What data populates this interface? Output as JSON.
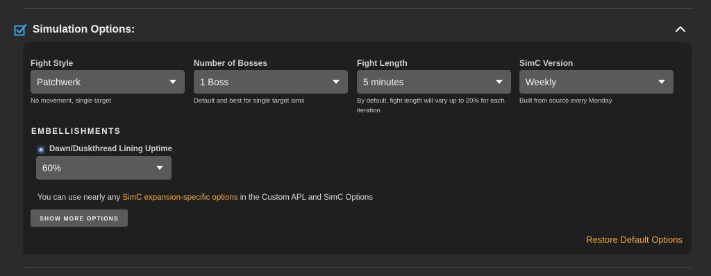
{
  "section": {
    "title": "Simulation Options:",
    "checked": true,
    "accent_color": "#3aa6e0"
  },
  "fields": [
    {
      "label": "Fight Style",
      "value": "Patchwerk",
      "helper": "No movement, single target"
    },
    {
      "label": "Number of Bosses",
      "value": "1 Boss",
      "helper": "Default and best for single target sims"
    },
    {
      "label": "Fight Length",
      "value": "5 minutes",
      "helper": "By default, fight length will vary up to 20% for each iteration"
    },
    {
      "label": "SimC Version",
      "value": "Weekly",
      "helper": "Built from source every Monday"
    }
  ],
  "embellishments": {
    "heading": "EMBELLISHMENTS",
    "item_label": "Dawn/Duskthread Lining Uptime",
    "item_value": "60%"
  },
  "info": {
    "prefix": "You can use nearly any ",
    "link": "SimC expansion-specific options",
    "suffix": " in the Custom APL and SimC Options"
  },
  "buttons": {
    "show_more": "SHOW MORE OPTIONS",
    "restore": "Restore Default Options"
  },
  "colors": {
    "link": "#f0a830",
    "panel_bg": "#1f1f1f",
    "page_bg": "#2b2b2b",
    "select_bg": "#5a5a5a"
  }
}
